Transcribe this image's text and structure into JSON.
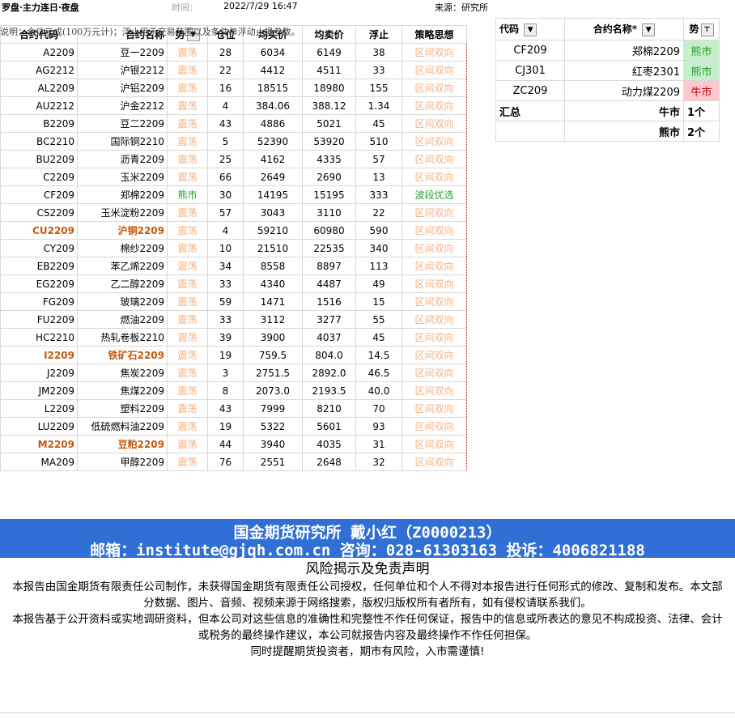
{
  "top": {
    "title": "罗盘·主力连日·夜盘",
    "time_label": "时间：",
    "time_value": "2022/7/29 16:47",
    "source": "来源：研究所",
    "note": "说明：仓位三成(100万元计)；浮止用于交易范围以及条件单浮动止损参数。"
  },
  "table": {
    "headers": [
      "合约代码",
      "合约名称",
      "势",
      "仓位",
      "均买价",
      "均卖价",
      "浮止",
      "策略思想"
    ],
    "rows": [
      {
        "code": "A2209",
        "name": "豆一2209",
        "trend": "震荡",
        "pos": "28",
        "buy": "6034",
        "sell": "6149",
        "stop": "38",
        "strat": "区间双向"
      },
      {
        "code": "AG2212",
        "name": "沪银2212",
        "trend": "震荡",
        "pos": "22",
        "buy": "4412",
        "sell": "4511",
        "stop": "33",
        "strat": "区间双向"
      },
      {
        "code": "AL2209",
        "name": "沪铝2209",
        "trend": "震荡",
        "pos": "16",
        "buy": "18515",
        "sell": "18980",
        "stop": "155",
        "strat": "区间双向"
      },
      {
        "code": "AU2212",
        "name": "沪金2212",
        "trend": "震荡",
        "pos": "4",
        "buy": "384.06",
        "sell": "388.12",
        "stop": "1.34",
        "strat": "区间双向"
      },
      {
        "code": "B2209",
        "name": "豆二2209",
        "trend": "震荡",
        "pos": "43",
        "buy": "4886",
        "sell": "5021",
        "stop": "45",
        "strat": "区间双向"
      },
      {
        "code": "BC2210",
        "name": "国际铜2210",
        "trend": "震荡",
        "pos": "5",
        "buy": "52390",
        "sell": "53920",
        "stop": "510",
        "strat": "区间双向"
      },
      {
        "code": "BU2209",
        "name": "沥青2209",
        "trend": "震荡",
        "pos": "25",
        "buy": "4162",
        "sell": "4335",
        "stop": "57",
        "strat": "区间双向"
      },
      {
        "code": "C2209",
        "name": "玉米2209",
        "trend": "震荡",
        "pos": "66",
        "buy": "2649",
        "sell": "2690",
        "stop": "13",
        "strat": "区间双向"
      },
      {
        "code": "CF209",
        "name": "郑棉2209",
        "trend": "熊市",
        "pos": "30",
        "buy": "14195",
        "sell": "15195",
        "stop": "333",
        "strat": "波段优选"
      },
      {
        "code": "CS2209",
        "name": "玉米淀粉2209",
        "trend": "震荡",
        "pos": "57",
        "buy": "3043",
        "sell": "3110",
        "stop": "22",
        "strat": "区间双向"
      },
      {
        "code": "CU2209",
        "name": "沪铜2209",
        "trend": "震荡",
        "pos": "4",
        "buy": "59210",
        "sell": "60980",
        "stop": "590",
        "strat": "区间双向"
      },
      {
        "code": "CY209",
        "name": "棉纱2209",
        "trend": "震荡",
        "pos": "10",
        "buy": "21510",
        "sell": "22535",
        "stop": "340",
        "strat": "区间双向"
      },
      {
        "code": "EB2209",
        "name": "苯乙烯2209",
        "trend": "震荡",
        "pos": "34",
        "buy": "8558",
        "sell": "8897",
        "stop": "113",
        "strat": "区间双向"
      },
      {
        "code": "EG2209",
        "name": "乙二醇2209",
        "trend": "震荡",
        "pos": "33",
        "buy": "4340",
        "sell": "4487",
        "stop": "49",
        "strat": "区间双向"
      },
      {
        "code": "FG209",
        "name": "玻璃2209",
        "trend": "震荡",
        "pos": "59",
        "buy": "1471",
        "sell": "1516",
        "stop": "15",
        "strat": "区间双向"
      },
      {
        "code": "FU2209",
        "name": "燃油2209",
        "trend": "震荡",
        "pos": "33",
        "buy": "3112",
        "sell": "3277",
        "stop": "55",
        "strat": "区间双向"
      },
      {
        "code": "HC2210",
        "name": "热轧卷板2210",
        "trend": "震荡",
        "pos": "39",
        "buy": "3900",
        "sell": "4037",
        "stop": "45",
        "strat": "区间双向"
      },
      {
        "code": "I2209",
        "name": "铁矿石2209",
        "trend": "震荡",
        "pos": "19",
        "buy": "759.5",
        "sell": "804.0",
        "stop": "14.5",
        "strat": "区间双向"
      },
      {
        "code": "J2209",
        "name": "焦炭2209",
        "trend": "震荡",
        "pos": "3",
        "buy": "2751.5",
        "sell": "2892.0",
        "stop": "46.5",
        "strat": "区间双向"
      },
      {
        "code": "JM2209",
        "name": "焦煤2209",
        "trend": "震荡",
        "pos": "8",
        "buy": "2073.0",
        "sell": "2193.5",
        "stop": "40.0",
        "strat": "区间双向"
      },
      {
        "code": "L2209",
        "name": "塑料2209",
        "trend": "震荡",
        "pos": "43",
        "buy": "7999",
        "sell": "8210",
        "stop": "70",
        "strat": "区间双向"
      },
      {
        "code": "LU2209",
        "name": "低硫燃料油2209",
        "trend": "震荡",
        "pos": "19",
        "buy": "5322",
        "sell": "5601",
        "stop": "93",
        "strat": "区间双向"
      },
      {
        "code": "M2209",
        "name": "豆粕2209",
        "trend": "震荡",
        "pos": "44",
        "buy": "3940",
        "sell": "4035",
        "stop": "31",
        "strat": "区间双向"
      },
      {
        "code": "MA209",
        "name": "甲醇2209",
        "trend": "震荡",
        "pos": "76",
        "buy": "2551",
        "sell": "2648",
        "stop": "32",
        "strat": "区间双向"
      }
    ]
  },
  "side": {
    "headers": [
      "代码",
      "合约名称*",
      "势"
    ],
    "rows": [
      {
        "code": "CF209",
        "name": "郑棉2209",
        "trend": "熊市"
      },
      {
        "code": "CJ301",
        "name": "红枣2301",
        "trend": "熊市"
      },
      {
        "code": "ZC209",
        "name": "动力煤2209",
        "trend": "牛市"
      }
    ],
    "summary_label": "汇总",
    "bull_label": "牛市",
    "bull_count": "1个",
    "bear_label": "熊市",
    "bear_count": "2个"
  },
  "banner": {
    "line1": "国金期货研究所   戴小红（Z0000213）",
    "line2": "邮箱：institute@gjqh.com.cn 咨询：028-61303163 投诉：4006821188"
  },
  "disclaimer": {
    "title": "风险揭示及免责声明",
    "p1": "本报告由国金期货有限责任公司制作，未获得国金期货有限责任公司授权，任何单位和个人不得对本报告进行任何形式的修改、复制和发布。本文部分数据、图片、音频、视频来源于网络搜索，版权归版权所有者所有，如有侵权请联系我们。",
    "p2": "本报告基于公开资料或实地调研资料，但本公司对这些信息的准确性和完整性不作任何保证，报告中的信息或所表达的意见不构成投资、法律、会计或税务的最终操作建议，本公司就报告内容及最终操作不作任何担保。",
    "p3": "同时提醒期货投资者，期市有风险，入市需谨慎!"
  },
  "colors": {
    "banner": "#2f6fd6",
    "trend_range": "#f4b183",
    "bear": "#2ca02c",
    "bull": "#c00000",
    "highlight": "#c55a11"
  }
}
